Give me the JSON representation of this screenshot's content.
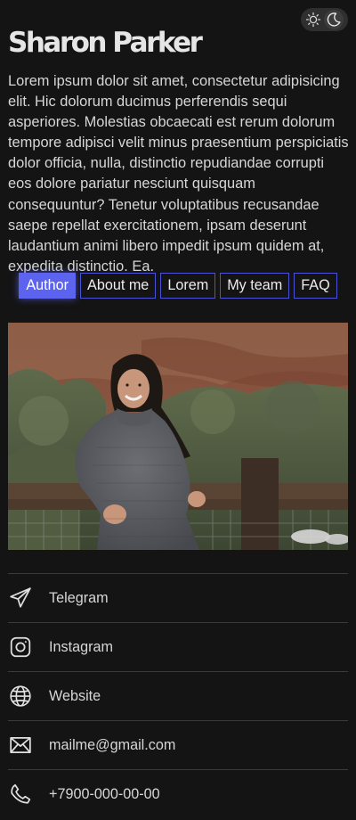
{
  "header": {
    "name": "Sharon Parker",
    "bio": "Lorem ipsum dolor sit amet, consectetur adipisicing elit. Hic dolorum ducimus perferendis sequi asperiores. Molestias obcaecati est rerum dolorum tempore adipisci velit minus praesentium perspiciatis dolor officia, nulla, distinctio repudiandae corrupti eos dolore pariatur nesciunt quisquam consequuntur? Tenetur voluptatibus recusandae saepe repellat exercitationem, ipsam deserunt laudantium animi libero impedit ipsum quidem at, expedita distinctio. Ea."
  },
  "theme_toggle": {
    "icons": [
      "sun-icon",
      "moon-icon"
    ],
    "active": "moon"
  },
  "tabs": [
    {
      "label": "Author",
      "active": true
    },
    {
      "label": "About me",
      "active": false
    },
    {
      "label": "Lorem",
      "active": false
    },
    {
      "label": "My team",
      "active": false
    },
    {
      "label": "FAQ",
      "active": false
    }
  ],
  "contacts": [
    {
      "label": "Telegram",
      "icon": "telegram-icon"
    },
    {
      "label": "Instagram",
      "icon": "instagram-icon"
    },
    {
      "label": "Website",
      "icon": "globe-icon"
    },
    {
      "label": "mailme@gmail.com",
      "icon": "mail-icon"
    },
    {
      "label": "+7900-000-00-00",
      "icon": "phone-icon"
    }
  ],
  "colors": {
    "background": "#141414",
    "accent": "#5b63ef",
    "tab_border": "#4b52d6",
    "divider": "#3a3a3a"
  }
}
